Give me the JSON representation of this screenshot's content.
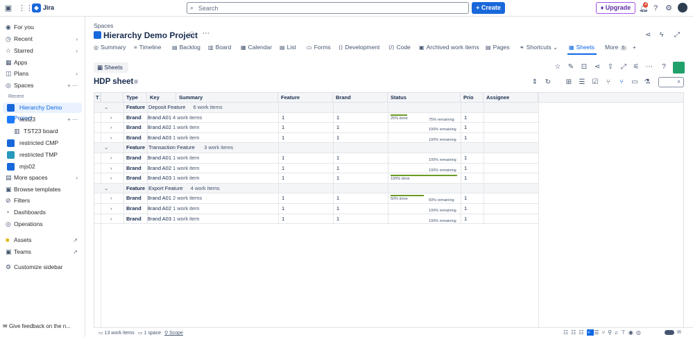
{
  "topbar": {
    "app_name": "Jira",
    "search_placeholder": "Search",
    "create_label": "Create",
    "upgrade_label": "Upgrade",
    "notification_count": "4"
  },
  "sidebar": {
    "items": [
      {
        "label": "For you",
        "icon": "person-circle-icon"
      },
      {
        "label": "Recent",
        "icon": "clock-icon"
      },
      {
        "label": "Starred",
        "icon": "star-icon"
      },
      {
        "label": "Apps",
        "icon": "apps-icon"
      },
      {
        "label": "Plans",
        "icon": "plans-icon"
      },
      {
        "label": "Spaces",
        "icon": "spaces-icon"
      }
    ],
    "recent_header": "Recent",
    "spaces": [
      {
        "label": "Hierarchy Demo Project",
        "color": "#1868db"
      },
      {
        "label": "test23",
        "color": "#1d7afc"
      },
      {
        "label": "TST23 board",
        "color": ""
      },
      {
        "label": "restricted CMP",
        "color": "#1868db"
      },
      {
        "label": "restricted TMP",
        "color": "#2898bd"
      },
      {
        "label": "mjs02",
        "color": "#1868db"
      }
    ],
    "more_spaces": "More spaces",
    "browse_templates": "Browse templates",
    "bottom": [
      {
        "label": "Filters"
      },
      {
        "label": "Dashboards"
      },
      {
        "label": "Operations"
      },
      {
        "label": "Assets"
      },
      {
        "label": "Teams"
      },
      {
        "label": "Customize sidebar"
      }
    ],
    "feedback": "Give feedback on the n..."
  },
  "header": {
    "breadcrumb": "Spaces",
    "project_title": "Hierarchy Demo Project",
    "tabs": [
      "Summary",
      "Timeline",
      "Backlog",
      "Board",
      "Calendar",
      "List",
      "Forms",
      "Development",
      "Code",
      "Archived work items",
      "Pages",
      "Shortcuts",
      "Sheets",
      "More"
    ],
    "more_count": "5",
    "active_tab": "Sheets"
  },
  "sheet": {
    "sheets_button": "Sheets",
    "title": "HDP sheet",
    "columns": [
      "T",
      "Type",
      "Key",
      "Summary",
      "Feature",
      "Brand",
      "Status",
      "Prio",
      "Assignee"
    ],
    "rows": [
      {
        "group": true,
        "type": "Feature",
        "key": "Deposit Feature",
        "summary": "6 work items"
      },
      {
        "type": "Brand",
        "key": "Brand A01",
        "summary": "4 work items",
        "feature": "1",
        "brand": "1",
        "done": "25% done",
        "remaining": "75% remaining",
        "fill": 0.25,
        "prio": "1"
      },
      {
        "type": "Brand",
        "key": "Brand A02",
        "summary": "1 work item",
        "feature": "1",
        "brand": "1",
        "done": "",
        "remaining": "100% remaining",
        "fill": 0,
        "prio": "1"
      },
      {
        "type": "Brand",
        "key": "Brand A03",
        "summary": "1 work item",
        "feature": "1",
        "brand": "1",
        "done": "",
        "remaining": "100% remaining",
        "fill": 0,
        "prio": "1"
      },
      {
        "group": true,
        "type": "Feature",
        "key": "Transaction Feature",
        "summary": "3 work items"
      },
      {
        "type": "Brand",
        "key": "Brand A01",
        "summary": "1 work item",
        "feature": "1",
        "brand": "1",
        "done": "",
        "remaining": "100% remaining",
        "fill": 0,
        "prio": "1"
      },
      {
        "type": "Brand",
        "key": "Brand A02",
        "summary": "1 work item",
        "feature": "1",
        "brand": "1",
        "done": "",
        "remaining": "100% remaining",
        "fill": 0,
        "prio": "1"
      },
      {
        "type": "Brand",
        "key": "Brand A03",
        "summary": "1 work item",
        "feature": "1",
        "brand": "1",
        "done": "100% done",
        "remaining": "",
        "fill": 1,
        "prio": "1"
      },
      {
        "group": true,
        "type": "Feature",
        "key": "Export Feature",
        "summary": "4 work items"
      },
      {
        "type": "Brand",
        "key": "Brand A01",
        "summary": "2 work items",
        "feature": "1",
        "brand": "1",
        "done": "50% done",
        "remaining": "50% remaining",
        "fill": 0.5,
        "prio": "1"
      },
      {
        "type": "Brand",
        "key": "Brand A02",
        "summary": "1 work item",
        "feature": "1",
        "brand": "1",
        "done": "",
        "remaining": "100% remaining",
        "fill": 0,
        "prio": "1"
      },
      {
        "type": "Brand",
        "key": "Brand A03",
        "summary": "1 work item",
        "feature": "1",
        "brand": "1",
        "done": "",
        "remaining": "100% remaining",
        "fill": 0,
        "prio": "1"
      }
    ]
  },
  "footer": {
    "work_items": "13 work items",
    "spaces": "1 space",
    "scope": "Scope"
  }
}
